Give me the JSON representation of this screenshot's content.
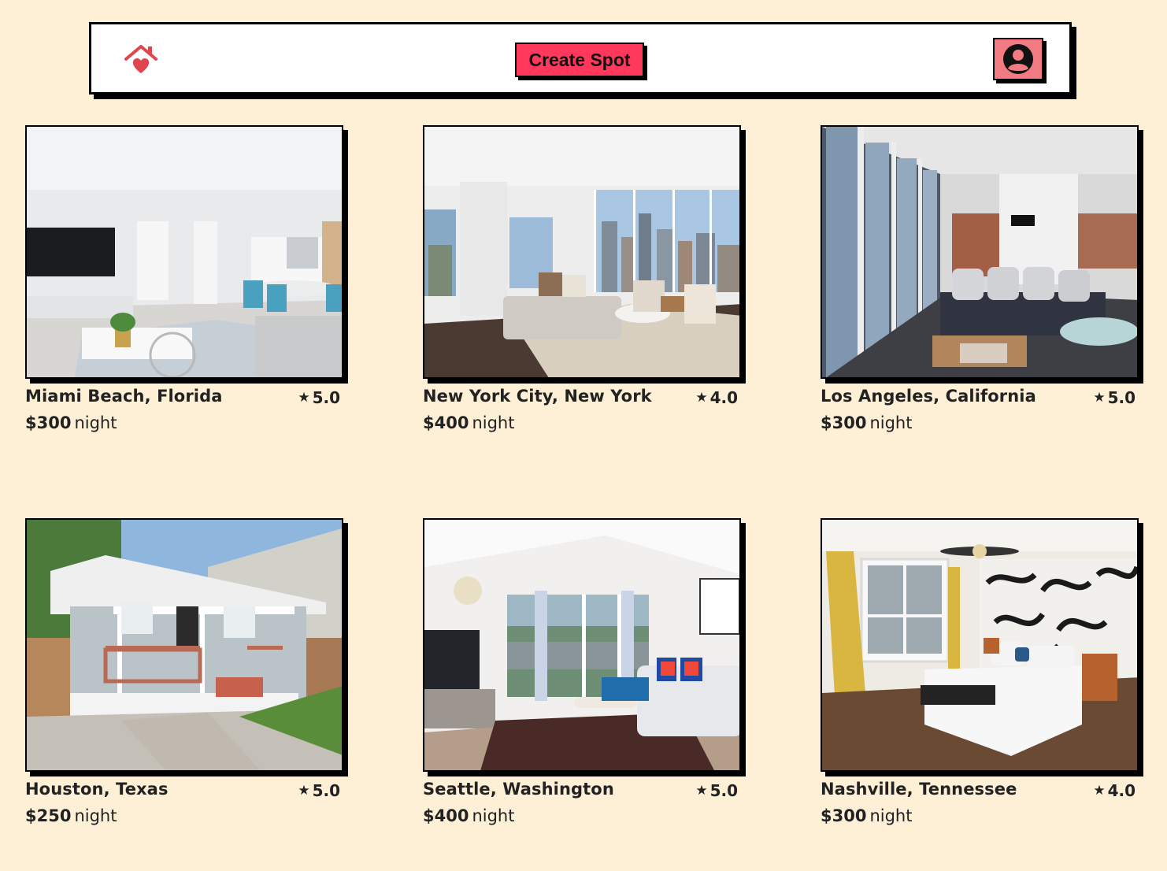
{
  "header": {
    "logo_icon": "house-heart-icon",
    "create_label": "Create Spot",
    "profile_icon": "user-circle-icon"
  },
  "colors": {
    "background": "#FEF0D7",
    "accent": "#FF385C",
    "profile_button": "#F27A82",
    "logo": "#E0464F"
  },
  "spots": [
    {
      "location": "Miami Beach, Florida",
      "rating": "5.0",
      "price": "$300",
      "per": "night",
      "photo": "modern living room with dining area"
    },
    {
      "location": "New York City, New York",
      "rating": "4.0",
      "price": "$400",
      "per": "night",
      "photo": "living room with city skyline windows"
    },
    {
      "location": "Los Angeles, California",
      "rating": "5.0",
      "price": "$300",
      "per": "night",
      "photo": "sunroom with sectional sofa"
    },
    {
      "location": "Houston, Texas",
      "rating": "5.0",
      "price": "$250",
      "per": "night",
      "photo": "house exterior with porch"
    },
    {
      "location": "Seattle, Washington",
      "rating": "5.0",
      "price": "$400",
      "per": "night",
      "photo": "living room with blue sofa"
    },
    {
      "location": "Nashville, Tennessee",
      "rating": "4.0",
      "price": "$300",
      "per": "night",
      "photo": "bedroom with music note mural"
    }
  ]
}
